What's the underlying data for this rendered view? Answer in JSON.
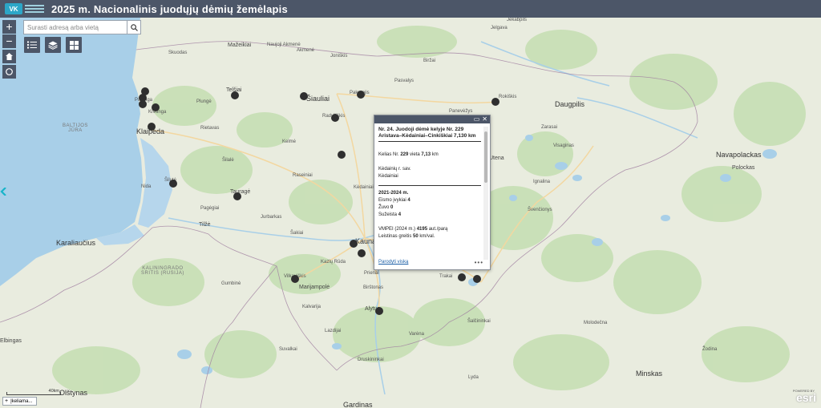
{
  "header": {
    "title": "2025 m. Nacionalinis juodųjų dėmių žemėlapis"
  },
  "search": {
    "placeholder": "Surasti adresą arba vietą"
  },
  "controls": {
    "zoom_in": "+",
    "zoom_out": "−"
  },
  "map": {
    "cities": [
      {
        "name": "Klaipėda",
        "size": "big"
      },
      {
        "name": "Šiauliai",
        "size": "big"
      },
      {
        "name": "Telšiai",
        "size": "mid"
      },
      {
        "name": "Kaunas",
        "size": "big"
      },
      {
        "name": "Tauragė",
        "size": "mid"
      },
      {
        "name": "Marijampolė",
        "size": "mid"
      },
      {
        "name": "Alytus",
        "size": "mid"
      },
      {
        "name": "Utena",
        "size": "mid"
      },
      {
        "name": "Daugpilis",
        "size": "big"
      },
      {
        "name": "Navapolackas",
        "size": "big"
      },
      {
        "name": "Polockas",
        "size": "mid"
      },
      {
        "name": "Minskas",
        "size": "big"
      },
      {
        "name": "Karaliaučius",
        "size": "big"
      },
      {
        "name": "Olštynas",
        "size": "big"
      },
      {
        "name": "Elbingas",
        "size": "mid"
      },
      {
        "name": "Gardinas",
        "size": "big"
      },
      {
        "name": "Tilžė",
        "size": "mid"
      },
      {
        "name": "Mažeikiai",
        "size": "mid"
      },
      {
        "name": "Jelgava",
        "size": "small"
      },
      {
        "name": "Jėkabpils",
        "size": "small"
      },
      {
        "name": "Rokiškis",
        "size": "small"
      },
      {
        "name": "Panevėžys",
        "size": "small"
      },
      {
        "name": "Kėdainiai",
        "size": "small"
      },
      {
        "name": "Radviliškis",
        "size": "small"
      },
      {
        "name": "Joniškis",
        "size": "small"
      },
      {
        "name": "Biržai",
        "size": "small"
      },
      {
        "name": "Pasvalys",
        "size": "small"
      },
      {
        "name": "Kelmė",
        "size": "small"
      },
      {
        "name": "Raseiniai",
        "size": "small"
      },
      {
        "name": "Šilalė",
        "size": "small"
      },
      {
        "name": "Šilutė",
        "size": "small"
      },
      {
        "name": "Plungė",
        "size": "small"
      },
      {
        "name": "Kretinga",
        "size": "small"
      },
      {
        "name": "Palanga",
        "size": "small"
      },
      {
        "name": "Skuodas",
        "size": "small"
      },
      {
        "name": "Rietavas",
        "size": "small"
      },
      {
        "name": "Akmenė",
        "size": "small"
      },
      {
        "name": "Naujoji Akmenė",
        "size": "small"
      },
      {
        "name": "Pakruojis",
        "size": "small"
      },
      {
        "name": "Jurbarkas",
        "size": "small"
      },
      {
        "name": "Šakiai",
        "size": "small"
      },
      {
        "name": "Kazlų Rūda",
        "size": "small"
      },
      {
        "name": "Vilkaviškis",
        "size": "small"
      },
      {
        "name": "Kalvarija",
        "size": "small"
      },
      {
        "name": "Lazdijai",
        "size": "small"
      },
      {
        "name": "Prienai",
        "size": "small"
      },
      {
        "name": "Birštonas",
        "size": "small"
      },
      {
        "name": "Trakai",
        "size": "small"
      },
      {
        "name": "Šalčininkai",
        "size": "small"
      },
      {
        "name": "Varėna",
        "size": "small"
      },
      {
        "name": "Druskininkai",
        "size": "small"
      },
      {
        "name": "Ignalina",
        "size": "small"
      },
      {
        "name": "Zarasai",
        "size": "small"
      },
      {
        "name": "Visaginas",
        "size": "small"
      },
      {
        "name": "Švenčionys",
        "size": "small"
      },
      {
        "name": "Suvalkai",
        "size": "small"
      },
      {
        "name": "Lyda",
        "size": "small"
      },
      {
        "name": "Molodečna",
        "size": "small"
      },
      {
        "name": "Žodina",
        "size": "small"
      },
      {
        "name": "Gumbinė",
        "size": "small"
      },
      {
        "name": "Pagėgiai",
        "size": "small"
      },
      {
        "name": "Nida",
        "size": "small"
      }
    ],
    "regions": [
      {
        "name": "KALININGRADO\nSRITIS (RUSIJA)"
      },
      {
        "name": "BALTIJOS\nJŪRA"
      }
    ]
  },
  "popup": {
    "title": "Nr. 24. Juodoji dėmė kelyje Nr. 229 Aristava–Kėdainiai–Cinkiškiai 7,130 km",
    "road_prefix": "Kelias Nr. ",
    "road_no": "229",
    "road_mid": " vieta ",
    "road_km": "7,13",
    "road_suffix": " km",
    "municipality": "Kėdainių r. sav.",
    "locality": "Kėdainiai",
    "period": "2021-2024 m.",
    "accidents_label": "Eismo įvykiai ",
    "accidents": "4",
    "killed_label": "Žuvo ",
    "killed": "0",
    "injured_label": "Sužeista ",
    "injured": "4",
    "aadt_label": "VMPEI (2024 m.) ",
    "aadt": "4195",
    "aadt_unit": " aut./parą",
    "speed_label": "Leistinas greitis ",
    "speed": "50",
    "speed_unit": " km/val.",
    "show_all": "Parodyti viską",
    "more": "•••"
  },
  "footer": {
    "legend_label": "Įkeliama...",
    "scale_label": "40km",
    "esri": "esri",
    "powered": "POWERED BY"
  },
  "colors": {
    "header": "#4c5668",
    "land": "#e9ecdf",
    "forest": "#c6dfb4",
    "water": "#a8cfe8",
    "dot": "#2f2f2f"
  }
}
